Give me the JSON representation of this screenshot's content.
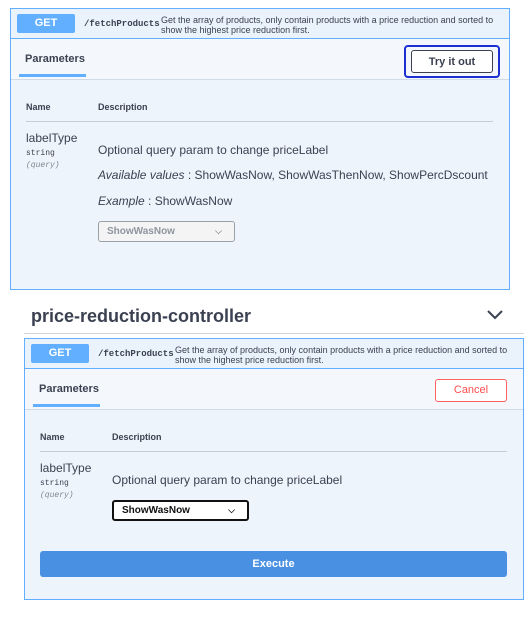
{
  "top_panel": {
    "method": "GET",
    "path": "/fetchProducts",
    "summary": "Get the array of products, only contain products with a price reduction and sorted to show the highest price reduction first.",
    "tab_label": "Parameters",
    "try_button_label": "Try it out",
    "col_name": "Name",
    "col_description": "Description",
    "param": {
      "name": "labelType",
      "type": "string",
      "location": "(query)",
      "description": "Optional query param to change priceLabel",
      "available_label": "Available values",
      "available_values": ": ShowWasNow, ShowWasThenNow, ShowPercDscount",
      "example_label": "Example",
      "example_value": ": ShowWasNow",
      "select_value": "ShowWasNow"
    }
  },
  "section": {
    "title": "price-reduction-controller"
  },
  "bottom_panel": {
    "method": "GET",
    "path": "/fetchProducts",
    "summary": "Get the array of products, only contain products with a price reduction and sorted to show the highest price reduction first.",
    "tab_label": "Parameters",
    "cancel_button_label": "Cancel",
    "col_name": "Name",
    "col_description": "Description",
    "param": {
      "name": "labelType",
      "type": "string",
      "location": "(query)",
      "description": "Optional query param to change priceLabel",
      "select_value": "ShowWasNow"
    },
    "execute_label": "Execute"
  },
  "colors": {
    "get_method": "#61affe",
    "execute": "#4990e2",
    "cancel": "#ff4d4d",
    "annotation": "#1c2fd0"
  }
}
